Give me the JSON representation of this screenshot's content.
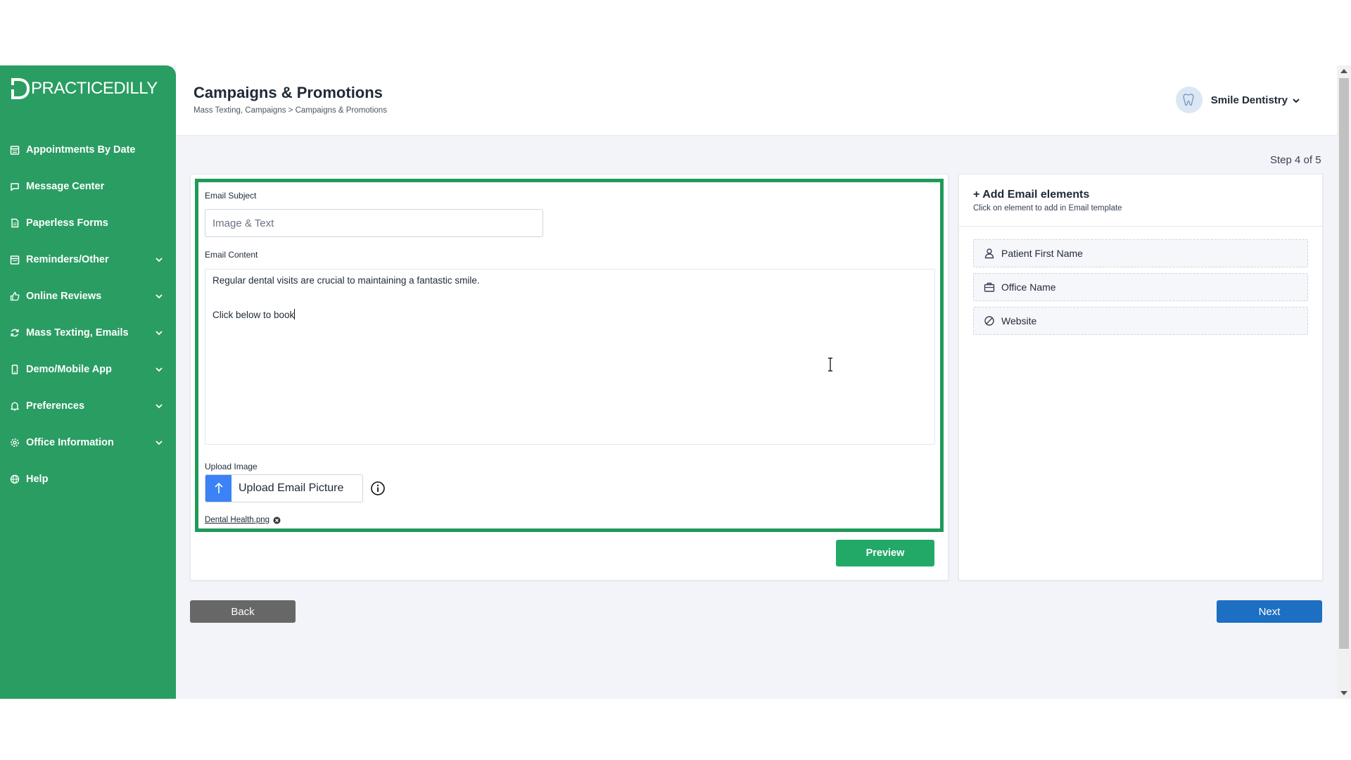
{
  "brand": {
    "logo_text": "PRACTICEDILLY"
  },
  "sidebar": {
    "items": [
      {
        "label": "Appointments By Date",
        "icon": "calendar-icon",
        "expandable": false
      },
      {
        "label": "Message Center",
        "icon": "chat-icon",
        "expandable": false
      },
      {
        "label": "Paperless Forms",
        "icon": "document-icon",
        "expandable": false
      },
      {
        "label": "Reminders/Other",
        "icon": "calendar-list-icon",
        "expandable": true
      },
      {
        "label": "Online Reviews",
        "icon": "thumbs-up-icon",
        "expandable": true
      },
      {
        "label": "Mass Texting, Emails",
        "icon": "refresh-icon",
        "expandable": true
      },
      {
        "label": "Demo/Mobile App",
        "icon": "mobile-icon",
        "expandable": true
      },
      {
        "label": "Preferences",
        "icon": "bell-icon",
        "expandable": true
      },
      {
        "label": "Office Information",
        "icon": "gear-icon",
        "expandable": true
      },
      {
        "label": "Help",
        "icon": "globe-icon",
        "expandable": false
      }
    ]
  },
  "header": {
    "title": "Campaigns & Promotions",
    "breadcrumb": "Mass Texting, Campaigns > Campaigns & Promotions",
    "user_name": "Smile Dentistry"
  },
  "step_text": "Step 4 of 5",
  "form": {
    "subject_label": "Email Subject",
    "subject_placeholder": "Image & Text",
    "subject_value": "",
    "content_label": "Email Content",
    "content_line1": "Regular dental visits are crucial to maintaining a fantastic smile.",
    "content_line2": "Click below to book",
    "upload_label": "Upload Image",
    "upload_button": "Upload Email Picture",
    "uploaded_file": "Dental Health.png",
    "preview_button": "Preview"
  },
  "elements_panel": {
    "title": "+ Add Email elements",
    "subtitle": "Click on element to add in Email template",
    "items": [
      {
        "label": "Patient First Name",
        "icon": "user-icon"
      },
      {
        "label": "Office Name",
        "icon": "briefcase-icon"
      },
      {
        "label": "Website",
        "icon": "link-icon"
      }
    ]
  },
  "footer": {
    "back_button": "Back",
    "next_button": "Next"
  },
  "colors": {
    "sidebar": "#2a9d63",
    "frame": "#1f9a5a",
    "preview": "#22a967",
    "next": "#1c6fc2",
    "back": "#676767",
    "upload": "#3b82f6"
  }
}
